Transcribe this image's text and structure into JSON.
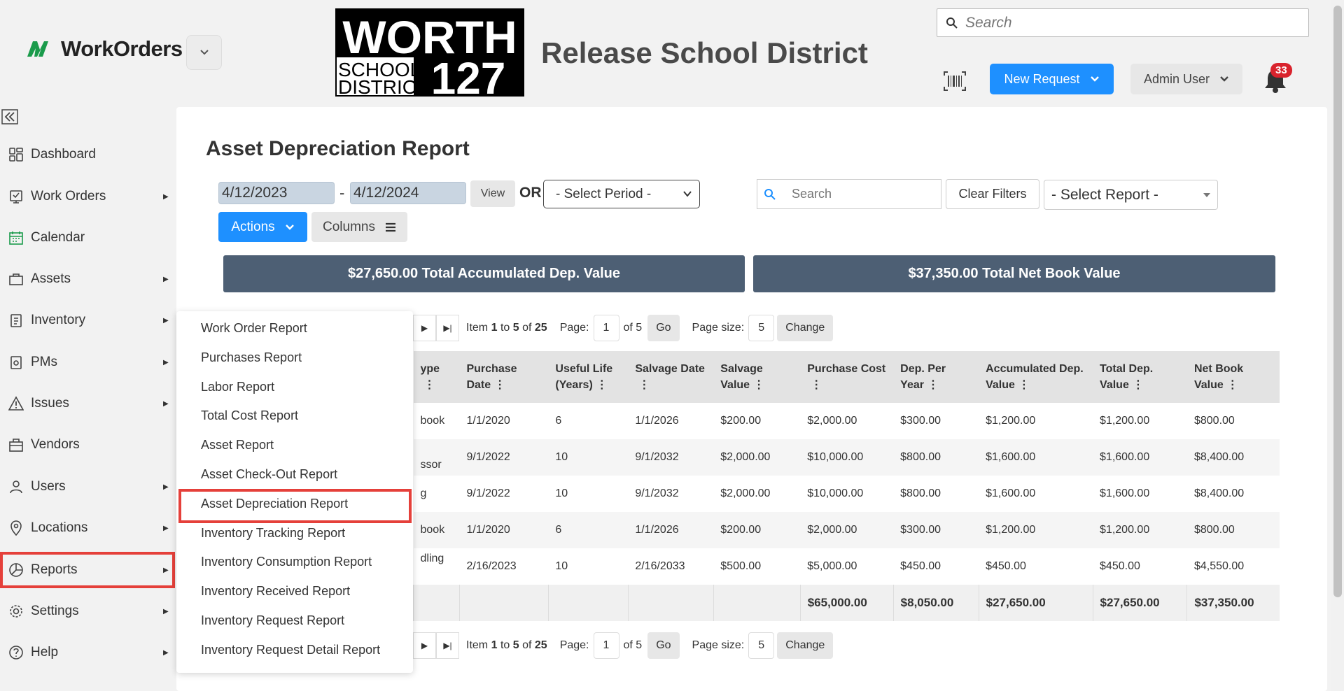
{
  "header": {
    "brand": "WorkOrders",
    "logo_lines": [
      "WORTH",
      "SCHOOL",
      "DISTRICT",
      "127"
    ],
    "district_title": "Release School District",
    "search_placeholder": "Search",
    "new_request_label": "New Request",
    "user_label": "Admin User",
    "notification_count": "33"
  },
  "sidebar": {
    "items": [
      {
        "label": "Dashboard",
        "icon": "dashboard-icon",
        "has_arrow": false
      },
      {
        "label": "Work Orders",
        "icon": "work-orders-icon",
        "has_arrow": true
      },
      {
        "label": "Calendar",
        "icon": "calendar-icon",
        "has_arrow": false
      },
      {
        "label": "Assets",
        "icon": "assets-icon",
        "has_arrow": true
      },
      {
        "label": "Inventory",
        "icon": "inventory-icon",
        "has_arrow": true
      },
      {
        "label": "PMs",
        "icon": "pms-icon",
        "has_arrow": true
      },
      {
        "label": "Issues",
        "icon": "issues-icon",
        "has_arrow": true
      },
      {
        "label": "Vendors",
        "icon": "vendors-icon",
        "has_arrow": false
      },
      {
        "label": "Users",
        "icon": "users-icon",
        "has_arrow": true
      },
      {
        "label": "Locations",
        "icon": "locations-icon",
        "has_arrow": true
      },
      {
        "label": "Reports",
        "icon": "reports-icon",
        "has_arrow": true
      },
      {
        "label": "Settings",
        "icon": "settings-icon",
        "has_arrow": true
      },
      {
        "label": "Help",
        "icon": "help-icon",
        "has_arrow": true
      }
    ]
  },
  "page": {
    "title": "Asset Depreciation Report",
    "date_from": "4/12/2023",
    "date_sep": "-",
    "date_to": "4/12/2024",
    "view_label": "View",
    "or_label": "OR",
    "period_select": "- Select Period -",
    "search_placeholder": "Search",
    "clear_filters_label": "Clear Filters",
    "report_select": "- Select Report -",
    "actions_label": "Actions",
    "columns_label": "Columns"
  },
  "summary": {
    "accumulated": "$27,650.00 Total Accumulated Dep. Value",
    "net_book": "$37,350.00 Total Net Book Value"
  },
  "pager": {
    "item_prefix": "Item",
    "item_from": "1",
    "to_label": "to",
    "item_to": "5",
    "of_label": "of",
    "item_total": "25",
    "page_label": "Page:",
    "page_value": "1",
    "page_of": "of 5",
    "go_label": "Go",
    "page_size_label": "Page size:",
    "page_size_value": "5",
    "change_label": "Change"
  },
  "table": {
    "headers": [
      "ype",
      "Purchase Date",
      "Useful Life (Years)",
      "Salvage Date",
      "Salvage Value",
      "Purchase Cost",
      "Dep. Per Year",
      "Accumulated Dep. Value",
      "Total Dep. Value",
      "Net Book Value"
    ],
    "rows": [
      [
        "book",
        "1/1/2020",
        "6",
        "1/1/2026",
        "$200.00",
        "$2,000.00",
        "$300.00",
        "$1,200.00",
        "$1,200.00",
        "$800.00"
      ],
      [
        "ssor",
        "9/1/2022",
        "10",
        "9/1/2032",
        "$2,000.00",
        "$10,000.00",
        "$800.00",
        "$1,600.00",
        "$1,600.00",
        "$8,400.00"
      ],
      [
        "g",
        "9/1/2022",
        "10",
        "9/1/2032",
        "$2,000.00",
        "$10,000.00",
        "$800.00",
        "$1,600.00",
        "$1,600.00",
        "$8,400.00"
      ],
      [
        "book",
        "1/1/2020",
        "6",
        "1/1/2026",
        "$200.00",
        "$2,000.00",
        "$300.00",
        "$1,200.00",
        "$1,200.00",
        "$800.00"
      ],
      [
        "dling",
        "2/16/2023",
        "10",
        "2/16/2033",
        "$500.00",
        "$5,000.00",
        "$450.00",
        "$450.00",
        "$450.00",
        "$4,550.00"
      ]
    ],
    "totals": [
      "",
      "",
      "",
      "",
      "",
      "$65,000.00",
      "$8,050.00",
      "$27,650.00",
      "$27,650.00",
      "$37,350.00"
    ]
  },
  "report_menu": {
    "items": [
      "Work Order Report",
      "Purchases Report",
      "Labor Report",
      "Total Cost Report",
      "Asset Report",
      "Asset Check-Out Report",
      "Asset Depreciation Report",
      "Inventory Tracking Report",
      "Inventory Consumption Report",
      "Inventory Received Report",
      "Inventory Request Report",
      "Inventory Request Detail Report"
    ]
  },
  "colors": {
    "accent_blue": "#1e90ff",
    "summary_bg": "#4d5f74",
    "highlight_red": "#e5403a",
    "badge_red": "#d9232d",
    "brand_green": "#1a9b4b"
  }
}
